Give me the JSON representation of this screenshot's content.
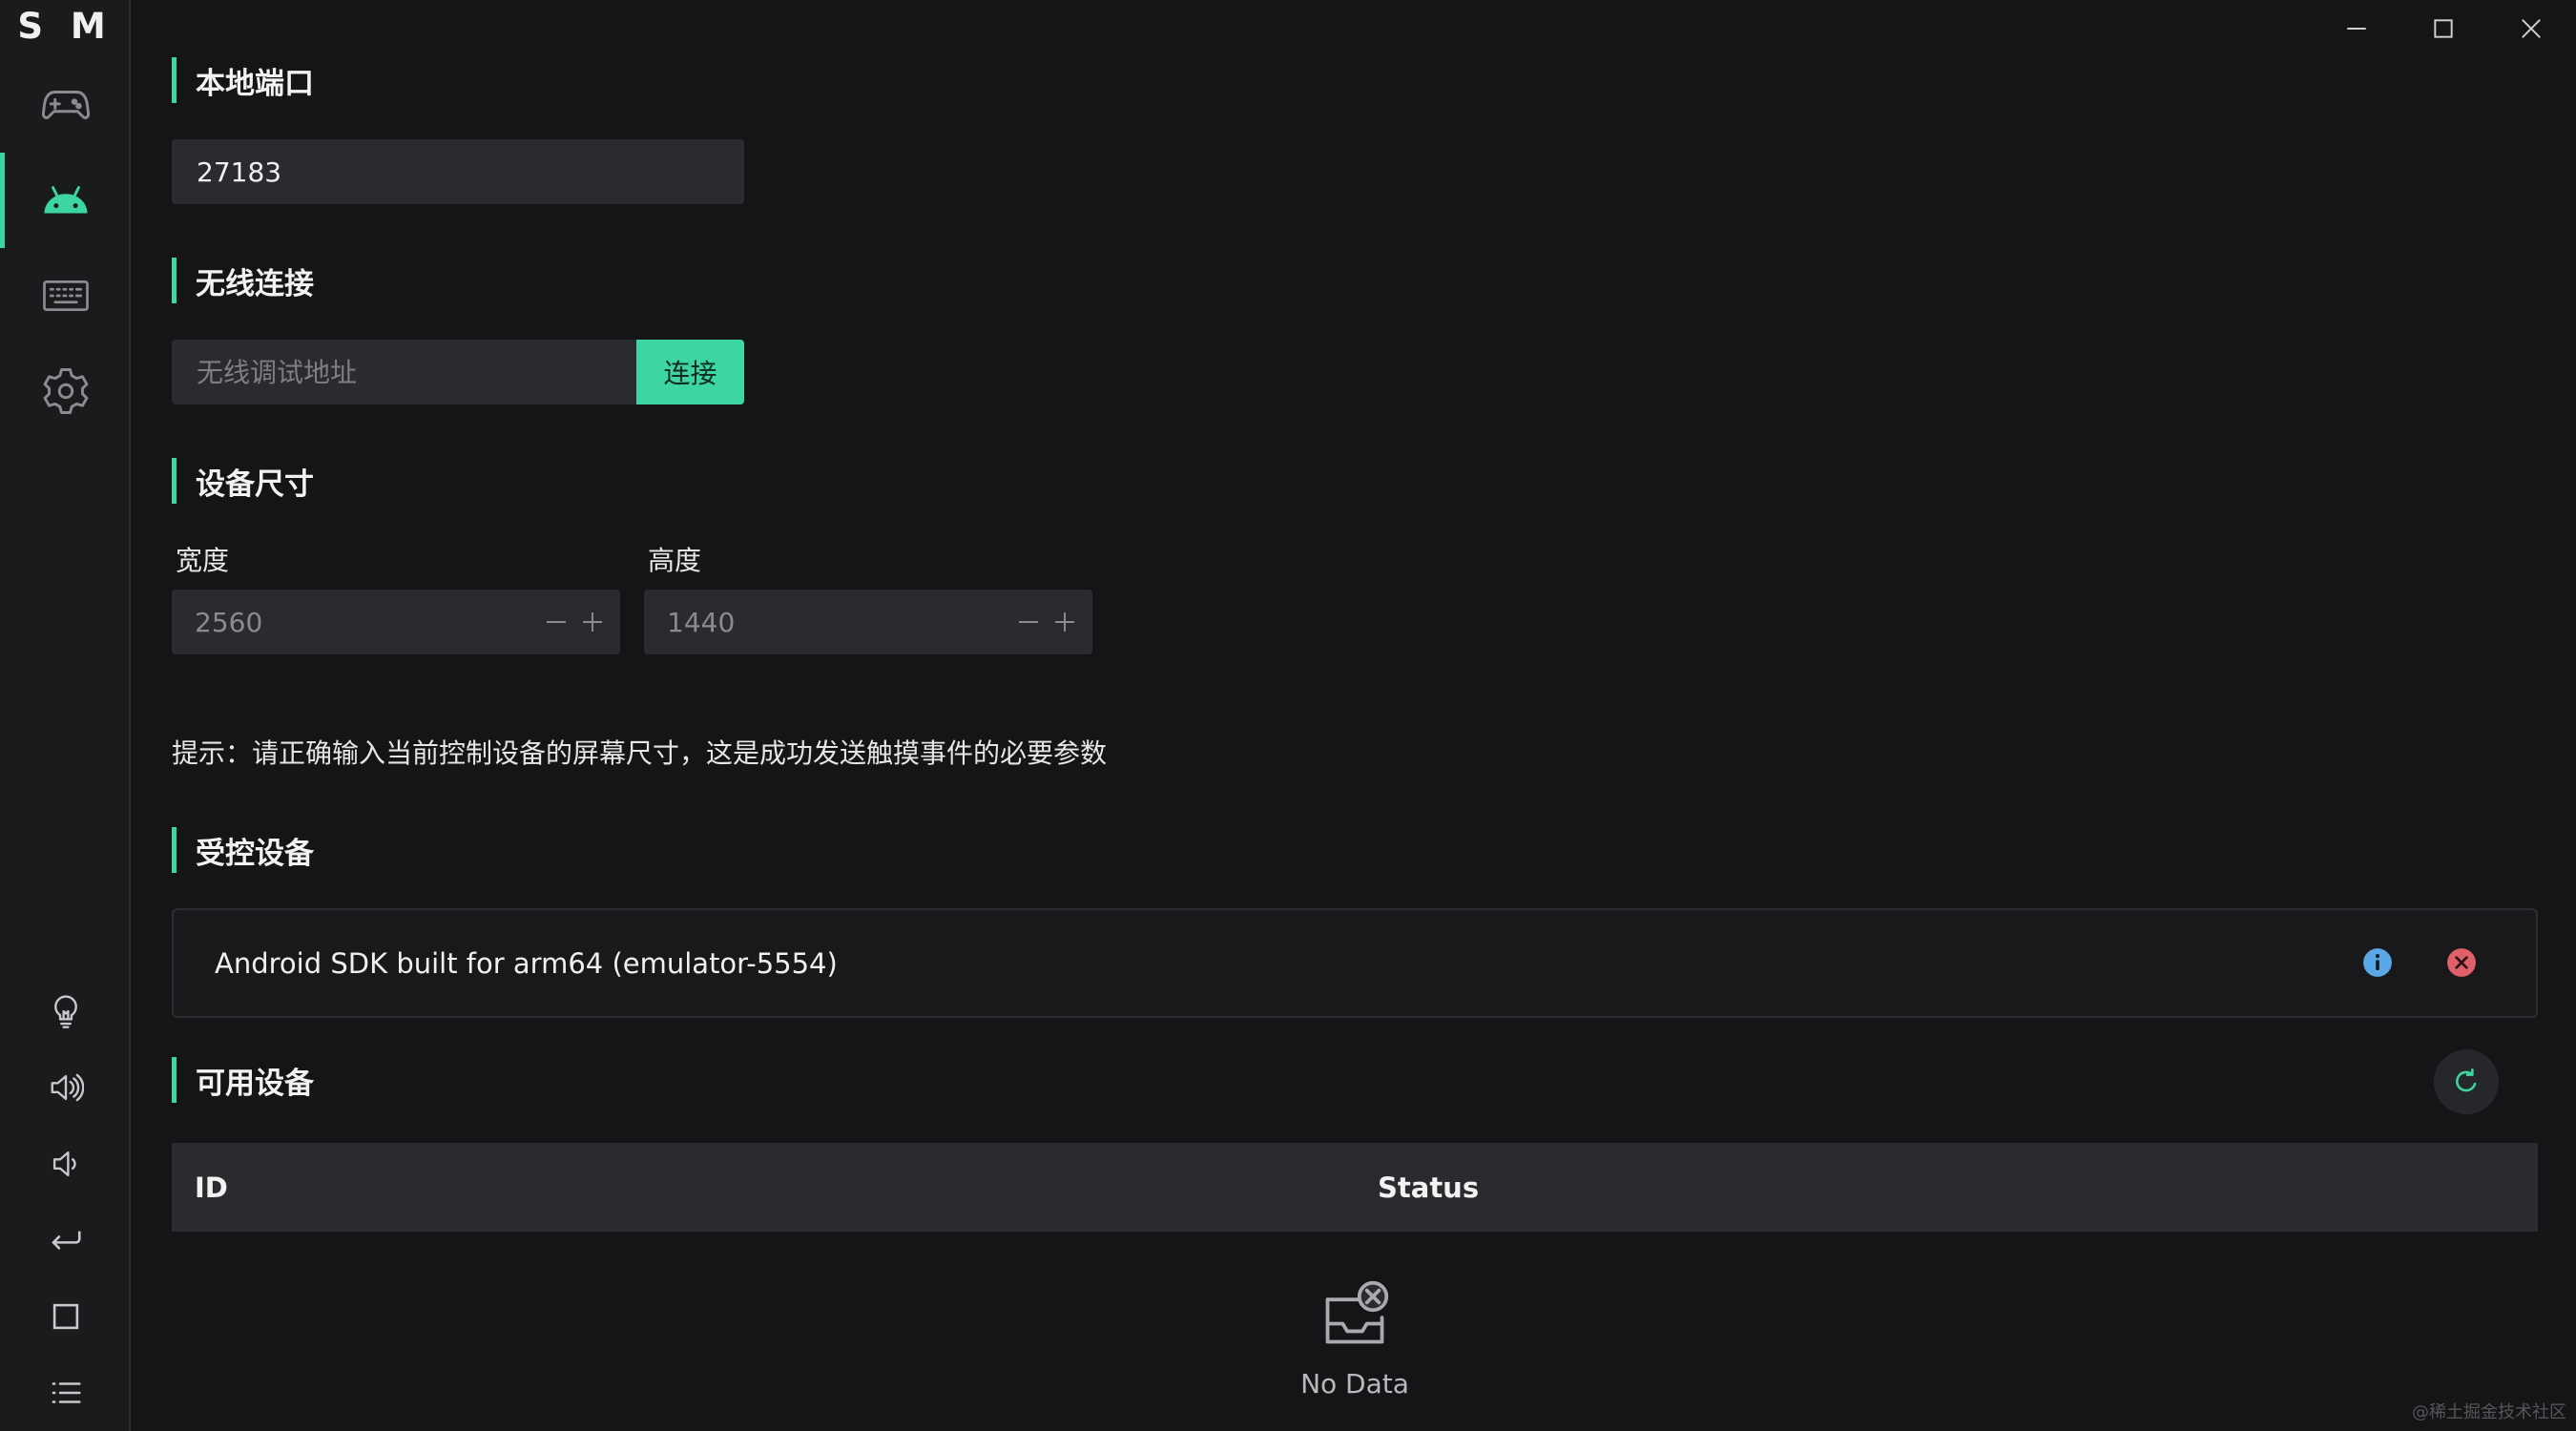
{
  "app": {
    "logo": "S M"
  },
  "sidebar": {
    "nav": [
      {
        "name": "gamepad",
        "icon": "gamepad-icon",
        "active": false
      },
      {
        "name": "android",
        "icon": "android-icon",
        "active": true
      },
      {
        "name": "keyboard",
        "icon": "keyboard-icon",
        "active": false
      },
      {
        "name": "settings",
        "icon": "gear-icon",
        "active": false
      }
    ],
    "tools": [
      {
        "name": "light",
        "icon": "lightbulb-icon"
      },
      {
        "name": "volume-up",
        "icon": "volume-up-icon"
      },
      {
        "name": "volume-down",
        "icon": "volume-down-icon"
      },
      {
        "name": "back",
        "icon": "back-arrow-icon"
      },
      {
        "name": "home",
        "icon": "square-icon"
      },
      {
        "name": "menu",
        "icon": "list-icon"
      }
    ]
  },
  "local_port": {
    "title": "本地端口",
    "value": "27183"
  },
  "wireless": {
    "title": "无线连接",
    "placeholder": "无线调试地址",
    "connect_label": "连接"
  },
  "device_size": {
    "title": "设备尺寸",
    "width_label": "宽度",
    "width_value": "2560",
    "height_label": "高度",
    "height_value": "1440"
  },
  "tip": "提示：请正确输入当前控制设备的屏幕尺寸，这是成功发送触摸事件的必要参数",
  "controlled": {
    "title": "受控设备",
    "device_name": "Android SDK built for arm64 (emulator-5554)"
  },
  "available": {
    "title": "可用设备",
    "columns": [
      "ID",
      "Status"
    ],
    "empty_text": "No Data"
  },
  "colors": {
    "accent": "#3ed6a0",
    "info": "#5aa9e6",
    "danger": "#e0606a"
  },
  "watermark": "@稀土掘金技术社区"
}
